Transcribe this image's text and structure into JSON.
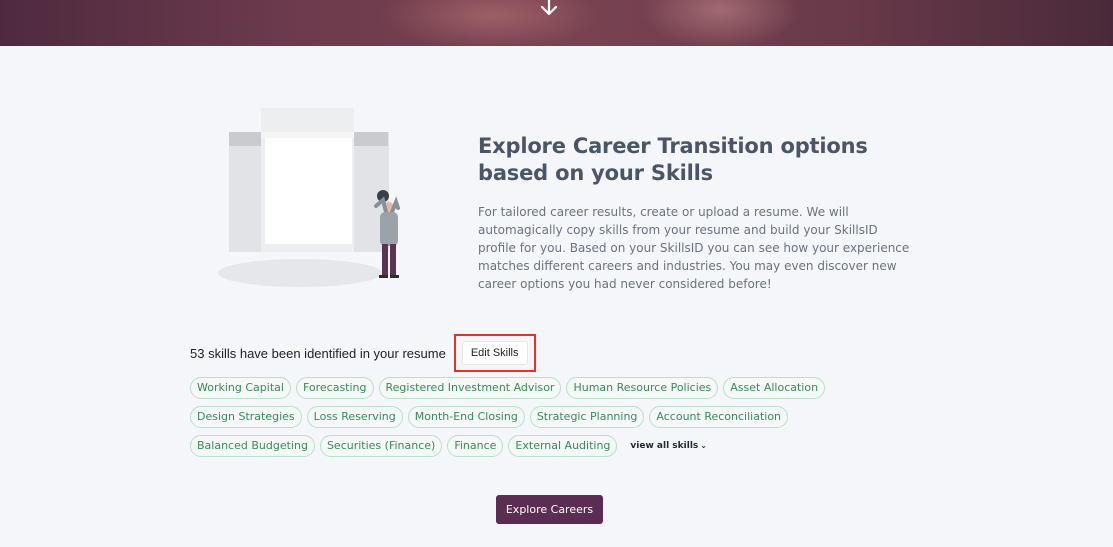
{
  "hero": {
    "scroll_icon": "arrow-down-icon"
  },
  "intro": {
    "headline": "Explore Career Transition options based on your Skills",
    "description": "For tailored career results, create or upload a resume. We will automagically copy skills from your resume and build your SkillsID profile for you. Based on your SkillsID you can see how your experience matches different careers and industries. You may even discover new career options you had never considered before!"
  },
  "skills": {
    "count_text": "53 skills have been identified in your resume",
    "edit_label": "Edit Skills",
    "items": [
      "Working Capital",
      "Forecasting",
      "Registered Investment Advisor",
      "Human Resource Policies",
      "Asset Allocation",
      "Design Strategies",
      "Loss Reserving",
      "Month-End Closing",
      "Strategic Planning",
      "Account Reconciliation",
      "Balanced Budgeting",
      "Securities (Finance)",
      "Finance",
      "External Auditing"
    ],
    "view_all_label": "view all skills",
    "view_all_icon": "chevron-down-icon"
  },
  "cta": {
    "explore_label": "Explore Careers"
  },
  "colors": {
    "brand": "#5b2d52",
    "chip_text": "#3a8a5a",
    "chip_border": "#b9e0c8",
    "highlight": "#e53222"
  }
}
